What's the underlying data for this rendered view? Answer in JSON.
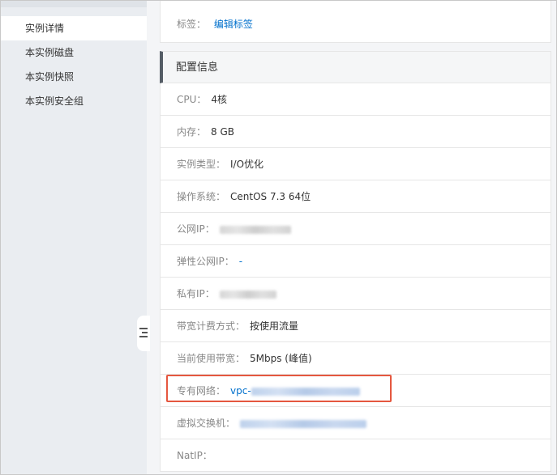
{
  "sidebar": {
    "items": [
      {
        "label": "实例详情",
        "active": true
      },
      {
        "label": "本实例磁盘",
        "active": false
      },
      {
        "label": "本实例快照",
        "active": false
      },
      {
        "label": "本实例安全组",
        "active": false
      }
    ]
  },
  "tags": {
    "label": "标签：",
    "edit_link": "编辑标签"
  },
  "config": {
    "title": "配置信息",
    "cpu": {
      "label": "CPU：",
      "value": "4核"
    },
    "memory": {
      "label": "内存：",
      "value": "8 GB"
    },
    "instance_type": {
      "label": "实例类型：",
      "value": "I/O优化"
    },
    "os": {
      "label": "操作系统：",
      "value": "CentOS 7.3 64位"
    },
    "public_ip": {
      "label": "公网IP："
    },
    "eip": {
      "label": "弹性公网IP：",
      "value": "-"
    },
    "private_ip": {
      "label": "私有IP："
    },
    "billing": {
      "label": "带宽计费方式：",
      "value": "按使用流量"
    },
    "bandwidth": {
      "label": "当前使用带宽：",
      "value": "5Mbps (峰值)"
    },
    "vpc": {
      "label": "专有网络：",
      "prefix": "vpc-"
    },
    "vswitch": {
      "label": "虚拟交换机："
    },
    "natip": {
      "label": "NatIP："
    }
  },
  "colors": {
    "link": "#0070cc",
    "highlight": "#e5573f",
    "sidebar_bg": "#eaedf1"
  }
}
